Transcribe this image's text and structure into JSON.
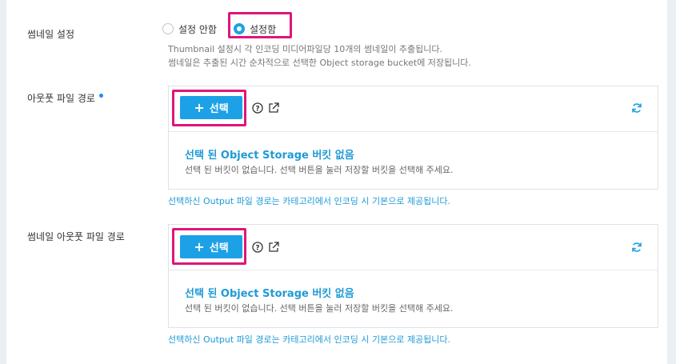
{
  "thumbnail": {
    "label": "썸네일 설정",
    "options": [
      {
        "label": "설정 안함",
        "selected": false
      },
      {
        "label": "설정함",
        "selected": true
      }
    ],
    "help_line1": "Thumbnail 설정시 각 인코딩 미디어파일당 10개의 썸네일이 추출됩니다.",
    "help_line2": "썸네일은 추출된 시간 순차적으로 선택한 Object storage bucket에 저장됩니다."
  },
  "output_path": {
    "label": "아웃풋 파일 경로",
    "required": true,
    "select_label": "선택",
    "empty_title": "선택 된 Object Storage 버킷 없음",
    "empty_desc": "선택 된 버킷이 없습니다. 선택 버튼을 눌러 저장할 버킷을 선택해 주세요.",
    "note": "선택하신 Output 파일 경로는 카테고리에서 인코딩 시 기본으로 제공됩니다."
  },
  "thumbnail_output_path": {
    "label": "썸네일 아웃풋 파일 경로",
    "select_label": "선택",
    "empty_title": "선택 된 Object Storage 버킷 없음",
    "empty_desc": "선택 된 버킷이 없습니다. 선택 버튼을 눌러 저장할 버킷을 선택해 주세요.",
    "note": "선택하신 Output 파일 경로는 카테고리에서 인코딩 시 기본으로 제공됩니다."
  },
  "colors": {
    "accent": "#1da1e6",
    "highlight": "#e0157a",
    "link_text": "#1e9ad6"
  },
  "icons": [
    "help-icon",
    "external-link-icon",
    "refresh-icon",
    "plus-icon"
  ]
}
